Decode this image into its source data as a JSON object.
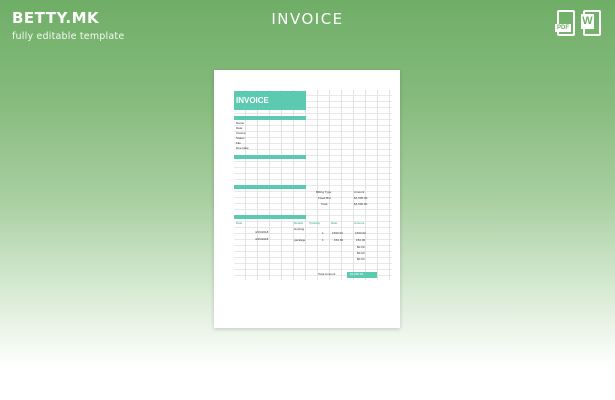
{
  "brand": {
    "logo": "BETTY.MK",
    "tagline": "fully editable template"
  },
  "title": "INVOICE",
  "file_formats": [
    {
      "icon": "pdf-file-icon",
      "label": "PDF"
    },
    {
      "icon": "word-file-icon",
      "label": "W"
    }
  ],
  "colors": {
    "accent": "#5ccab0",
    "header_green": "#6fae67"
  },
  "invoice": {
    "heading": "INVOICE",
    "from_fields": [
      "Name",
      "Date",
      "Invoice",
      "Status",
      "File",
      "Due Date"
    ],
    "billing": {
      "billing_type": "Billing Type",
      "amount": "Amount",
      "fixed_bid": "Fixed Bid",
      "total": "Total",
      "value1": "$1,500.00",
      "value2": "$1,500.00"
    },
    "items_header": [
      "Date",
      "Details",
      "Quantity",
      "Rate",
      "Amount"
    ],
    "rows": [
      {
        "date": "4/16/2018",
        "details": "Hosting",
        "qty": "1",
        "rate": "1500.00",
        "amount": "1500.00"
      },
      {
        "date": "4/26/2018",
        "details": "package",
        "qty": "1",
        "rate": "152.00",
        "amount": "152.00"
      }
    ],
    "extra_amounts": [
      "$0.00",
      "$0.00",
      "$0.00"
    ],
    "total_label": "Total Amount",
    "total_value": "$1,652.00"
  }
}
